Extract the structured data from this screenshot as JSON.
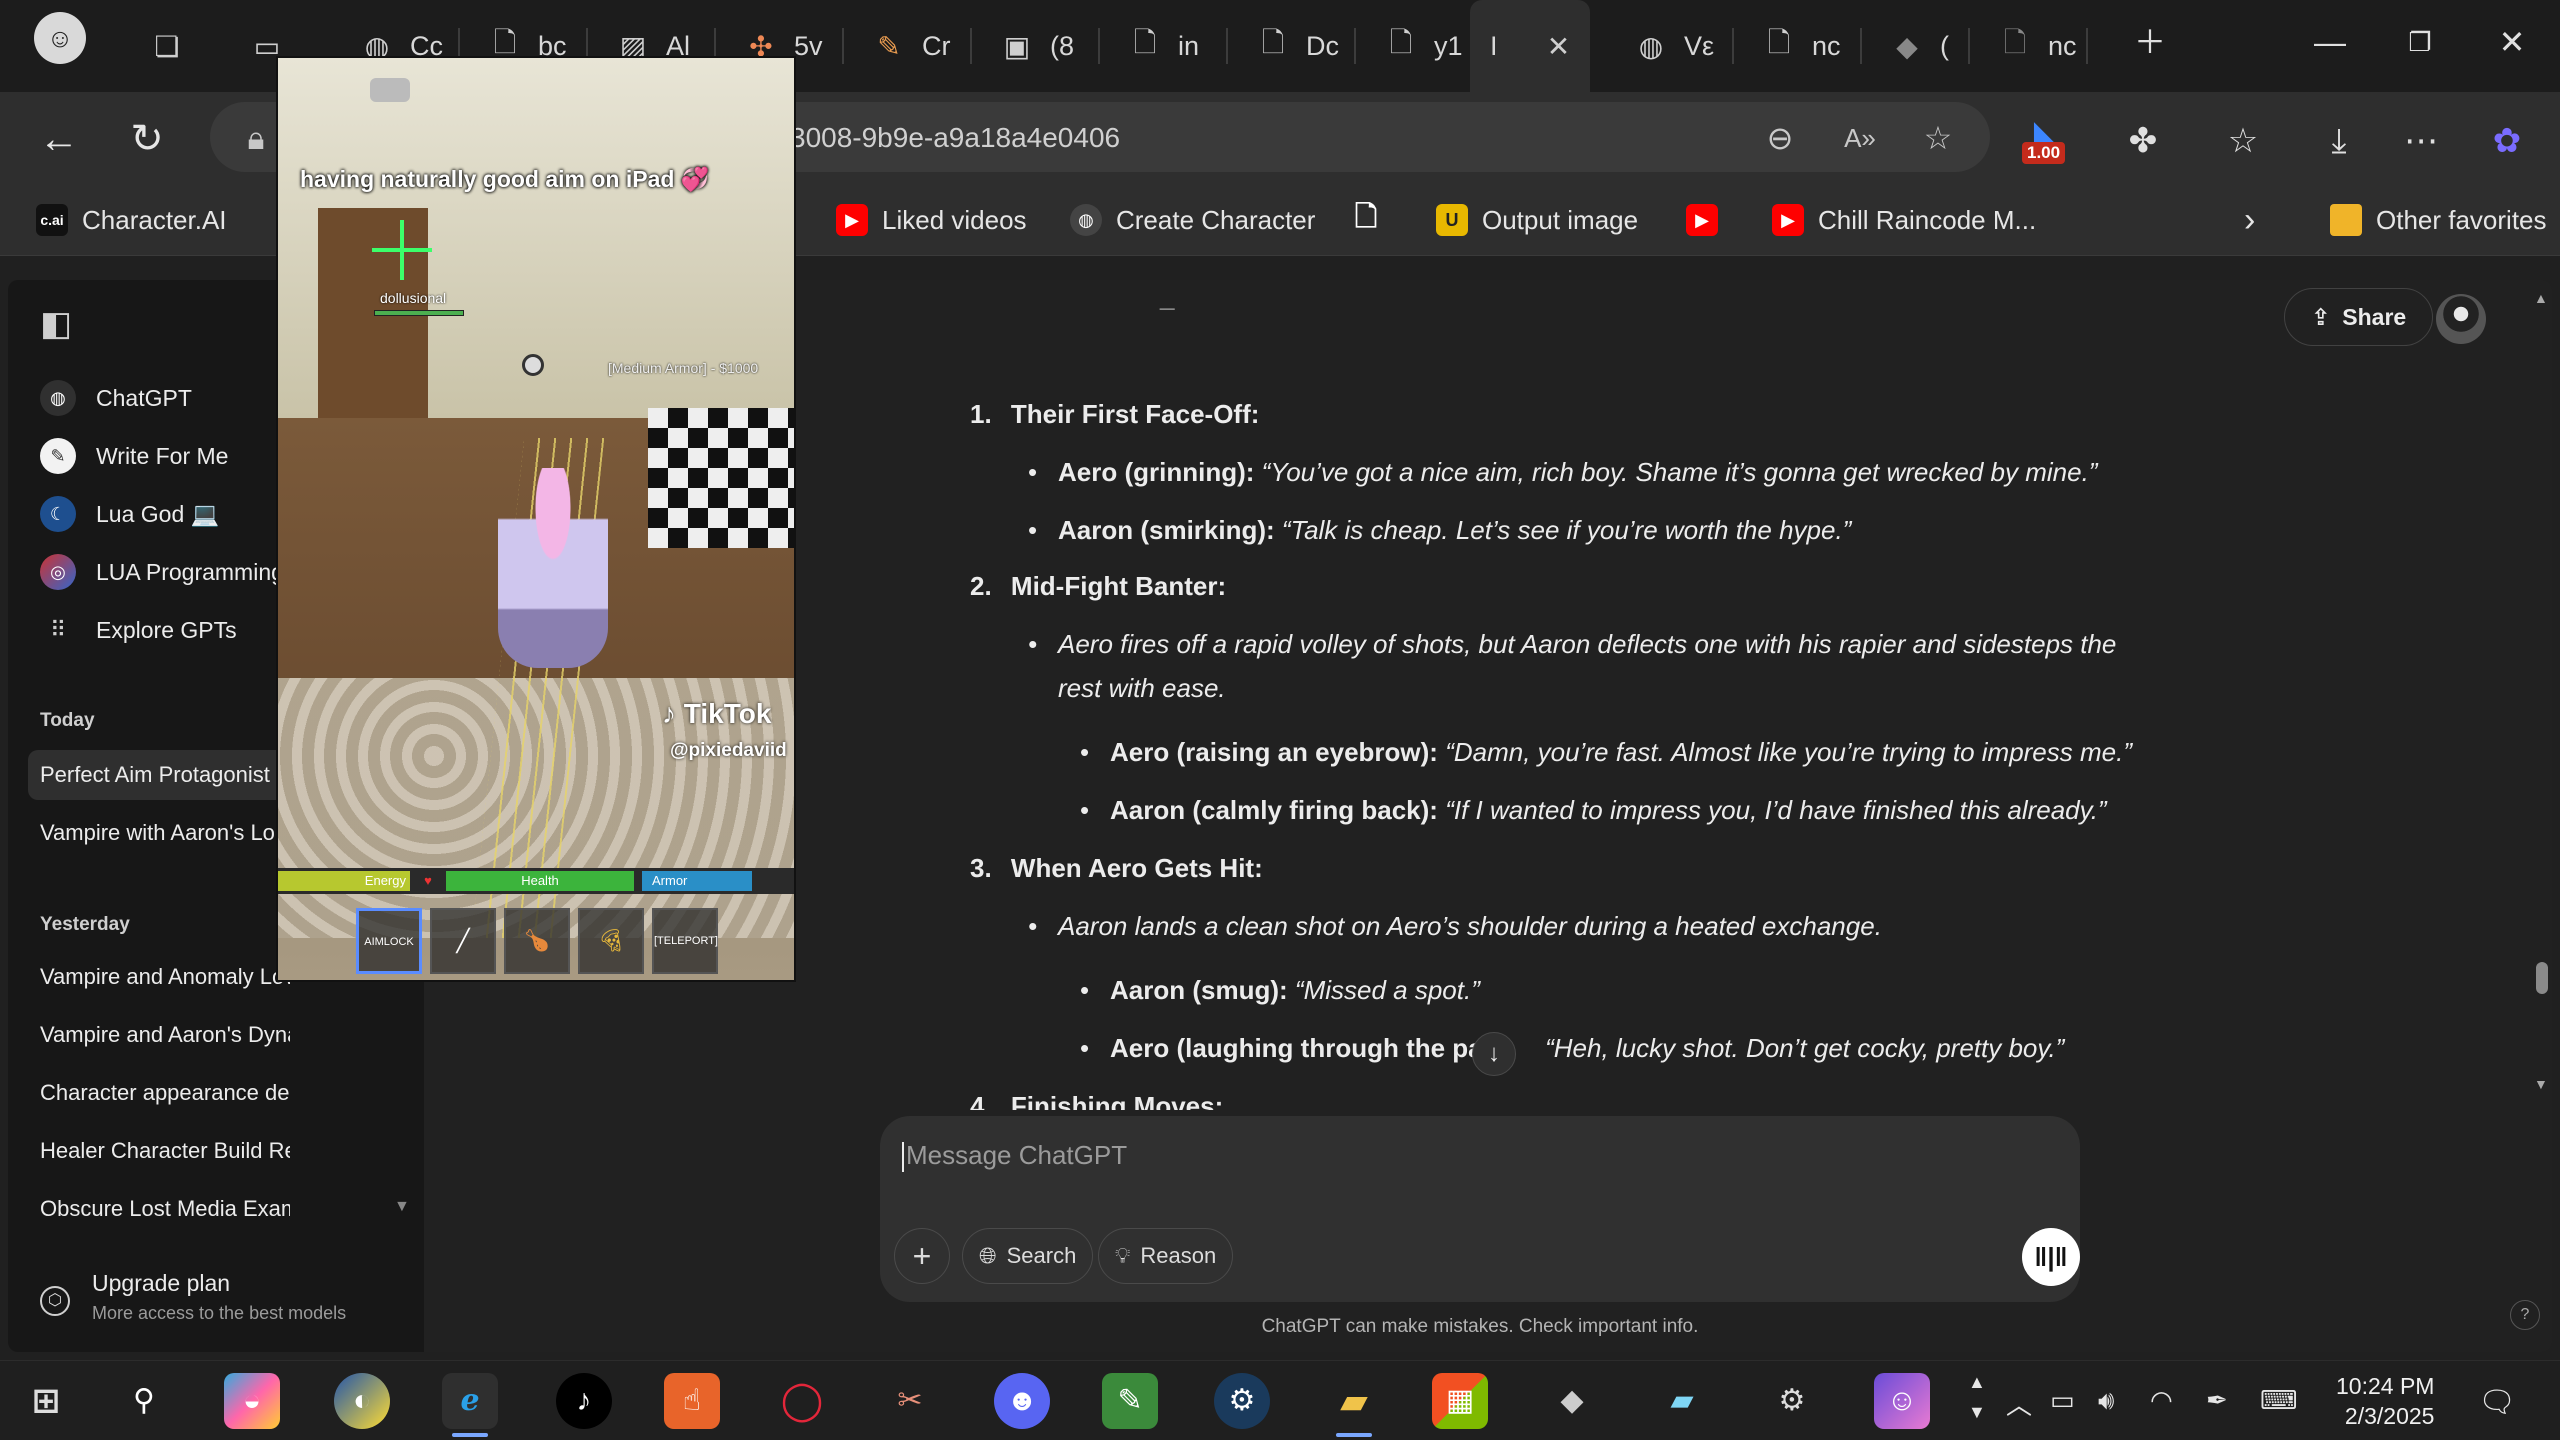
{
  "browser": {
    "tabs": [
      {
        "icon": "chatgpt-icon",
        "label": "Cc"
      },
      {
        "icon": "document-icon",
        "label": "bc"
      },
      {
        "icon": "image-icon",
        "label": "Al"
      },
      {
        "icon": "pinwheel-icon",
        "label": "5v"
      },
      {
        "icon": "pencil-icon",
        "label": "Cr"
      },
      {
        "icon": "photo-icon",
        "label": "(8"
      },
      {
        "icon": "document-icon",
        "label": "in"
      },
      {
        "icon": "document-icon",
        "label": "Dc"
      },
      {
        "icon": "document-icon",
        "label": "y1"
      },
      {
        "icon": "chatgpt-icon",
        "label": "Vε"
      },
      {
        "icon": "document-icon",
        "label": "nc"
      },
      {
        "icon": "roblox-icon",
        "label": "("
      },
      {
        "icon": "document-icon",
        "label": "nc"
      }
    ],
    "active_tab_label": "I",
    "url": "3008-9b9e-a9a18a4e0406",
    "extension_badge": "1.00",
    "bookmarks": [
      {
        "icon": "character-ai-icon",
        "label": "Character.AI",
        "color": "#111111"
      },
      {
        "icon": "youtube-icon",
        "label": "Liked videos",
        "color": "#ff0000"
      },
      {
        "icon": "chatgpt-icon",
        "label": "Create Character",
        "color": "#444444"
      },
      {
        "icon": "document-icon",
        "label": "",
        "color": "#444444"
      },
      {
        "icon": "output-icon",
        "label": "Output image",
        "color": "#e8b800"
      },
      {
        "icon": "youtube-icon",
        "label": "",
        "color": "#ff0000"
      },
      {
        "icon": "youtube-icon",
        "label": "Chill Raincode M...",
        "color": "#ff0000"
      }
    ],
    "other_favorites": "Other favorites"
  },
  "sidebar": {
    "items": [
      {
        "label": "ChatGPT",
        "icon": "chatgpt-icon"
      },
      {
        "label": "Write For Me",
        "icon": "pen-icon"
      },
      {
        "label": "Lua God 💻",
        "icon": "lua-god-icon"
      },
      {
        "label": "LUA Programming",
        "icon": "lua-icon"
      },
      {
        "label": "Explore GPTs",
        "icon": "grid-icon"
      }
    ],
    "today_heading": "Today",
    "today": [
      "Perfect Aim Protagonist",
      "Vampire with Aaron's Lo"
    ],
    "yesterday_heading": "Yesterday",
    "yesterday": [
      "Vampire and Anomaly Love",
      "Vampire and Aaron's Dynamic",
      "Character appearance descrip",
      "Healer Character Build Review",
      "Obscure Lost Media Examples"
    ],
    "upgrade_title": "Upgrade plan",
    "upgrade_sub": "More access to the best models"
  },
  "header": {
    "share_label": "Share"
  },
  "conversation": {
    "s1_num": "1.",
    "s1_title": "Their First Face-Off:",
    "s1_b1_speaker": "Aero (grinning):",
    "s1_b1_line": "“You’ve got a nice aim, rich boy. Shame it’s gonna get wrecked by mine.”",
    "s1_b2_speaker": "Aaron (smirking):",
    "s1_b2_line": "“Talk is cheap. Let’s see if you’re worth the hype.”",
    "s2_num": "2.",
    "s2_title": "Mid-Fight Banter:",
    "s2_b1_l1": "Aero fires off a rapid volley of shots, but Aaron deflects one with his rapier and sidesteps the",
    "s2_b1_l2": "rest with ease.",
    "s2_n1_speaker": "Aero (raising an eyebrow):",
    "s2_n1_line": "“Damn, you’re fast. Almost like you’re trying to impress me.”",
    "s2_n2_speaker": "Aaron (calmly firing back):",
    "s2_n2_line": "“If I wanted to impress you, I’d have finished this already.”",
    "s3_num": "3.",
    "s3_title": "When Aero Gets Hit:",
    "s3_b1": "Aaron lands a clean shot on Aero’s shoulder during a heated exchange.",
    "s3_n1_speaker": "Aaron (smug):",
    "s3_n1_line": "“Missed a spot.”",
    "s3_n2_speaker": "Aero (laughing through the pai",
    "s3_n2_line": "“Heh, lucky shot. Don’t get cocky, pretty boy.”",
    "s4_num": "4.",
    "s4_title": "Finishing Moves:"
  },
  "composer": {
    "placeholder": "Message ChatGPT",
    "search_label": "Search",
    "reason_label": "Reason"
  },
  "disclaimer": "ChatGPT can make mistakes. Check important info.",
  "video": {
    "caption": "having naturally good aim on iPad 💞",
    "player_tag": "dollusional",
    "armor_text": "[Medium Armor] - $1000",
    "tiktok_label": "TikTok",
    "handle": "@pixiedaviid",
    "energy_label": "Energy",
    "health_label": "Health",
    "armor_label": "Armor",
    "aimlock_label": "AIMLOCK",
    "teleport_label": "[TELEPORT]"
  },
  "taskbar": {
    "time": "10:24 PM",
    "date": "2/3/2025"
  }
}
